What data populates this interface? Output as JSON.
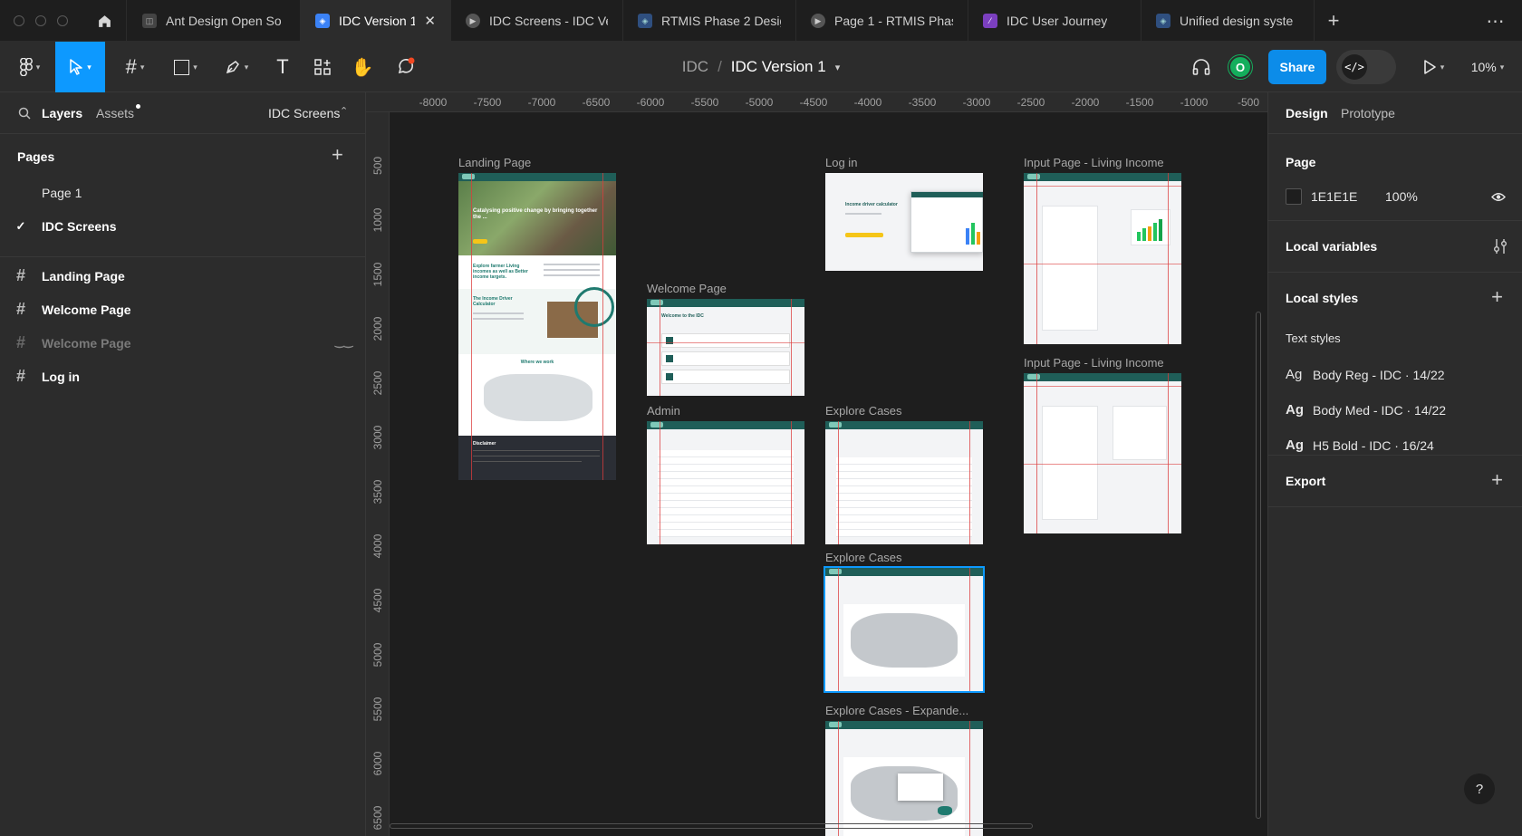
{
  "tabs": [
    {
      "label": "Ant Design Open So",
      "icon": "figma-file-icon",
      "active": false
    },
    {
      "label": "IDC Version 1",
      "icon": "figma-design-icon",
      "active": true
    },
    {
      "label": "IDC Screens - IDC Ve",
      "icon": "play-prototype-icon",
      "active": false
    },
    {
      "label": "RTMIS Phase 2 Desig",
      "icon": "figma-design-icon",
      "active": false
    },
    {
      "label": "Page 1 - RTMIS Phas",
      "icon": "play-prototype-icon",
      "active": false
    },
    {
      "label": "IDC User Journey",
      "icon": "figjam-file-icon",
      "active": false
    },
    {
      "label": "Unified design syste",
      "icon": "figma-design-icon",
      "active": false
    }
  ],
  "toolbar": {
    "project": "IDC",
    "separator": "/",
    "file_name": "IDC Version 1",
    "share_label": "Share",
    "avatar_initial": "O",
    "zoom": "10%",
    "dev_mode_icon": "code-icon"
  },
  "left_panel": {
    "layers_tab": "Layers",
    "assets_tab": "Assets",
    "current_page": "IDC Screens",
    "pages_title": "Pages",
    "pages": [
      {
        "label": "Page 1",
        "selected": false
      },
      {
        "label": "IDC Screens",
        "selected": true
      }
    ],
    "layers": [
      {
        "label": "Landing Page",
        "hidden": false
      },
      {
        "label": "Welcome Page",
        "hidden": false
      },
      {
        "label": "Welcome Page",
        "hidden": true
      },
      {
        "label": "Log in",
        "hidden": false
      }
    ]
  },
  "canvas": {
    "ruler_x": [
      "-8000",
      "-7500",
      "-7000",
      "-6500",
      "-6000",
      "-5500",
      "-5000",
      "-4500",
      "-4000",
      "-3500",
      "-3000",
      "-2500",
      "-2000",
      "-1500",
      "-1000",
      "-500"
    ],
    "ruler_y": [
      "500",
      "1000",
      "1500",
      "2000",
      "2500",
      "3000",
      "3500",
      "4000",
      "4500",
      "5000",
      "5500",
      "6000",
      "6500"
    ],
    "frames": [
      {
        "label": "Landing Page"
      },
      {
        "label": "Welcome Page"
      },
      {
        "label": "Admin"
      },
      {
        "label": "Log in"
      },
      {
        "label": "Explore Cases"
      },
      {
        "label": "Explore Cases"
      },
      {
        "label": "Explore Cases - Expande..."
      },
      {
        "label": "Input Page - Living Income"
      },
      {
        "label": "Input Page - Living Income"
      }
    ],
    "landing_hero_text": "Catalysing positive change by bringing together the ...",
    "landing_section_text": "Explore farmer Living incomes as well as Better income targets.",
    "landing_calc_title": "The Income Driver Calculator",
    "landing_where": "Where we work",
    "landing_disclaimer": "Disclaimer",
    "welcome_title": "Welcome to the IDC",
    "login_title": "Income driver calculator"
  },
  "right_panel": {
    "design_tab": "Design",
    "prototype_tab": "Prototype",
    "page_title": "Page",
    "page_color_hex": "1E1E1E",
    "page_color": "#1E1E1E",
    "page_opacity": "100%",
    "local_variables": "Local variables",
    "local_styles": "Local styles",
    "text_styles_title": "Text styles",
    "text_styles": [
      {
        "label": "Body Reg - IDC · 14/22"
      },
      {
        "label": "Body Med - IDC · 14/22"
      },
      {
        "label": "H5 Bold - IDC · 16/24"
      }
    ],
    "export": "Export"
  },
  "colors": {
    "accent_blue": "#0d99ff",
    "share_blue": "#0c8ce9",
    "avatar_green": "#14ae5c",
    "idc_teal": "#1f5e58"
  }
}
